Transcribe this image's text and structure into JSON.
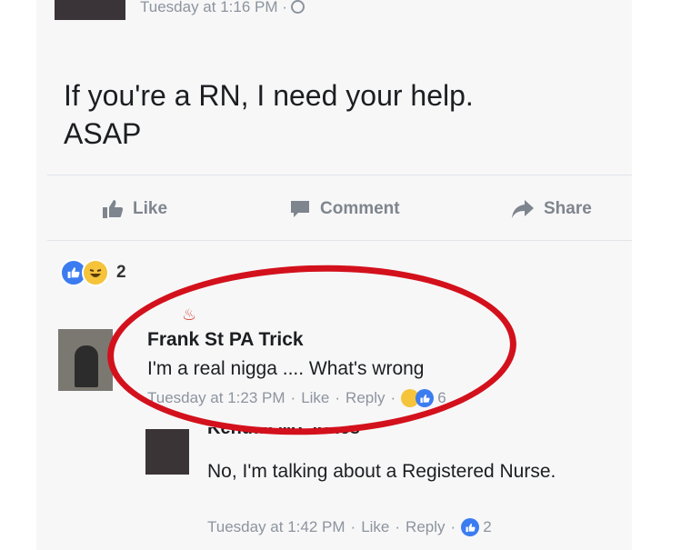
{
  "post": {
    "timestamp": "Tuesday at 1:16 PM ·",
    "text_line1": "If you're a RN, I need your help.",
    "text_line2": "ASAP"
  },
  "actions": {
    "like": "Like",
    "comment": "Comment",
    "share": "Share"
  },
  "reactions": {
    "count": "2"
  },
  "comments": [
    {
      "name": "Frank St PA Trick",
      "text": "I'm a real nigga .... What's wrong",
      "time": "Tuesday at 1:23 PM",
      "like": "Like",
      "reply": "Reply",
      "reaction_count": "6"
    },
    {
      "name": "Kendall No Jones",
      "text": "No, I'm talking about a Registered Nurse.",
      "time": "Tuesday at 1:42 PM",
      "like": "Like",
      "reply": "Reply",
      "reaction_count": "2"
    }
  ],
  "colors": {
    "highlight": "#d3111c",
    "like_blue": "#3b7cf0",
    "muted": "#8d949e"
  }
}
